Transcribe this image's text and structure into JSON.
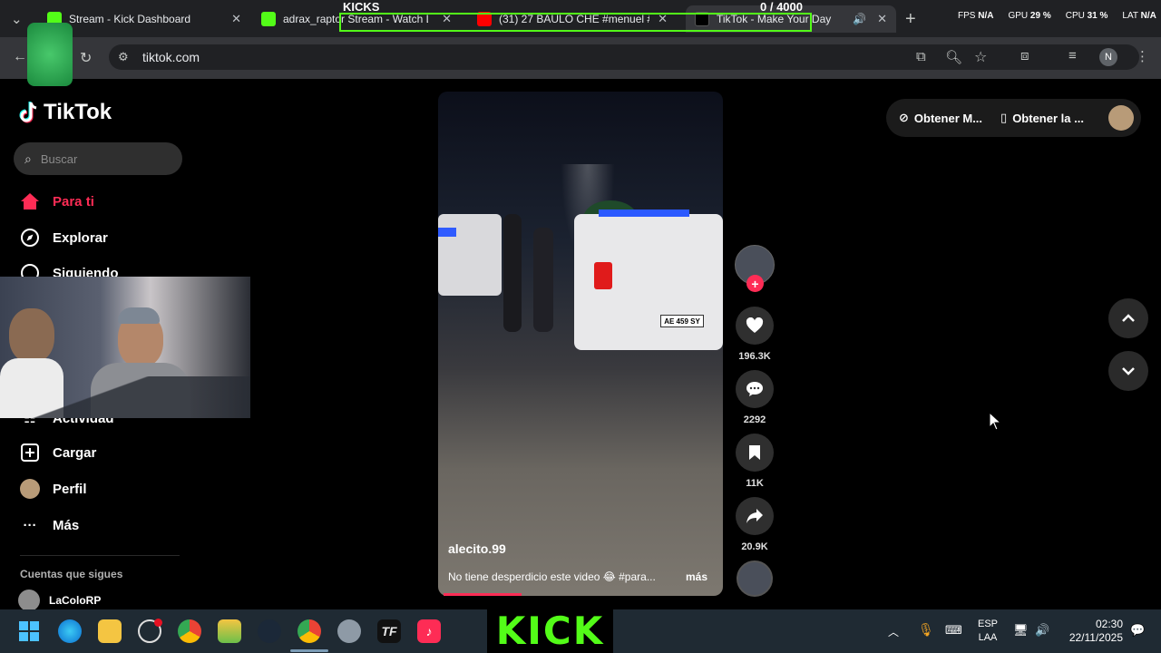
{
  "browser": {
    "tabs": [
      {
        "label": "Stream - Kick Dashboard",
        "color": "#53fc18"
      },
      {
        "label": "adrax_raptor Stream - Watch Li",
        "color": "#53fc18"
      },
      {
        "label": "(31) 27 BAULO CHE #menuel #",
        "color": "#ff0000"
      },
      {
        "label": "TikTok - Make Your Day",
        "color": "#ffffff"
      }
    ],
    "url": "tiktok.com",
    "profile_initial": "N"
  },
  "stream_overlay": {
    "kicks_label": "KICKS",
    "kicks_counter": "0   / 4000",
    "stats": [
      {
        "label": "FPS",
        "value": "N/A"
      },
      {
        "label": "GPU",
        "value": "29 %"
      },
      {
        "label": "CPU",
        "value": "31 %"
      },
      {
        "label": "LAT",
        "value": "N/A"
      }
    ]
  },
  "tiktok": {
    "logo": "TikTok",
    "search_placeholder": "Buscar",
    "nav": [
      {
        "label": "Para ti",
        "icon": "home-icon",
        "active": true
      },
      {
        "label": "Explorar",
        "icon": "compass-icon"
      },
      {
        "label": "Siguiendo",
        "icon": "following-icon"
      },
      {
        "label": "Actividad",
        "icon": "activity-icon"
      },
      {
        "label": "Cargar",
        "icon": "upload-icon"
      },
      {
        "label": "Perfil",
        "icon": "profile-icon"
      },
      {
        "label": "Más",
        "icon": "more-icon"
      }
    ],
    "following_header": "Cuentas que sigues",
    "following_accounts": [
      "LaColoRP"
    ],
    "get_buttons": [
      "Obtener M...",
      "Obtener la ..."
    ],
    "video": {
      "username": "alecito.99",
      "caption": "No tiene desperdicio este video 😂 #para...",
      "more": "más",
      "progress": 0.28,
      "plate": "AE 459 SY"
    },
    "actions": {
      "likes": "196.3K",
      "comments": "2292",
      "saves": "11K",
      "shares": "20.9K"
    }
  },
  "taskbar": {
    "kick_logo": "KICK",
    "lang_top": "ESP",
    "lang_bottom": "LAA",
    "time": "02:30",
    "date": "22/11/2025"
  },
  "colors": {
    "tiktok_red": "#fe2c55",
    "kick_green": "#53fc18"
  }
}
